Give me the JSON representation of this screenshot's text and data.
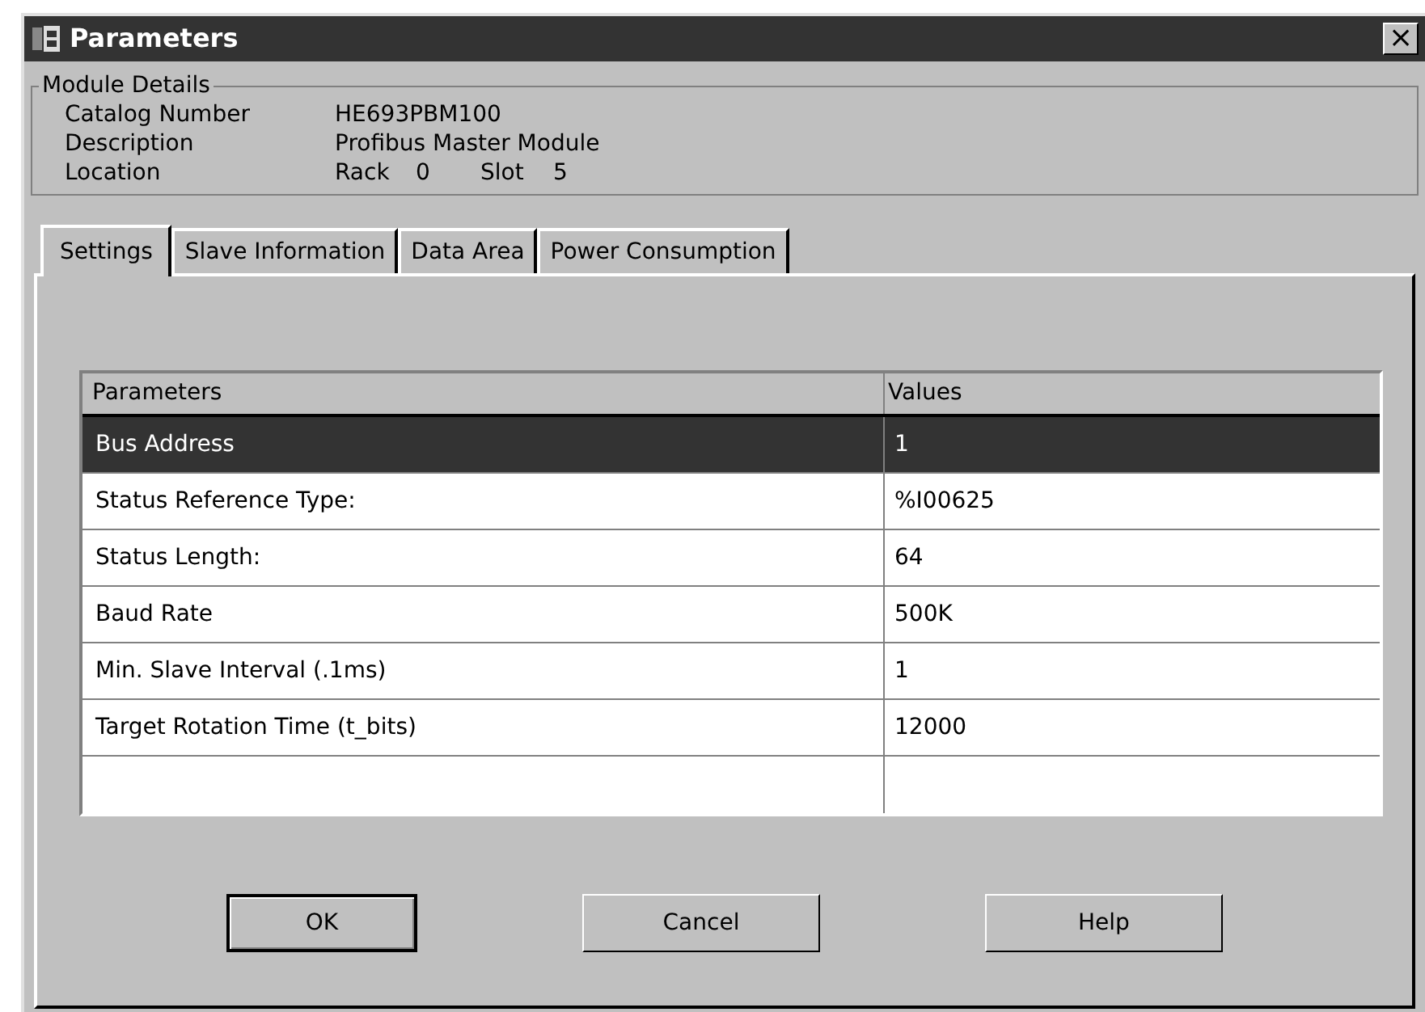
{
  "window": {
    "title": "Parameters",
    "close": "×"
  },
  "module_details": {
    "legend": "Module Details",
    "fields": [
      {
        "label": "Catalog Number",
        "value": "HE693PBM100"
      },
      {
        "label": "Description",
        "value": "Profibus Master Module"
      }
    ],
    "location": {
      "label": "Location",
      "rack_label": "Rack",
      "rack": "0",
      "slot_label": "Slot",
      "slot": "5"
    }
  },
  "tabs": [
    {
      "label": "Settings",
      "selected": true
    },
    {
      "label": "Slave Information",
      "selected": false
    },
    {
      "label": "Data Area",
      "selected": false
    },
    {
      "label": "Power Consumption",
      "selected": false
    }
  ],
  "table": {
    "columns": [
      "Parameters",
      "Values"
    ],
    "rows": [
      {
        "parameter": "Bus Address",
        "value": "1",
        "selected": true
      },
      {
        "parameter": "Status Reference Type:",
        "value": "%I00625",
        "selected": false
      },
      {
        "parameter": "Status Length:",
        "value": "64",
        "selected": false
      },
      {
        "parameter": "Baud Rate",
        "value": "500K",
        "selected": false
      },
      {
        "parameter": "Min. Slave Interval (.1ms)",
        "value": "1",
        "selected": false
      },
      {
        "parameter": "Target Rotation Time (t_bits)",
        "value": "12000",
        "selected": false
      }
    ]
  },
  "buttons": [
    {
      "label": "OK",
      "default": true
    },
    {
      "label": "Cancel",
      "default": false
    },
    {
      "label": "Help",
      "default": false
    }
  ]
}
